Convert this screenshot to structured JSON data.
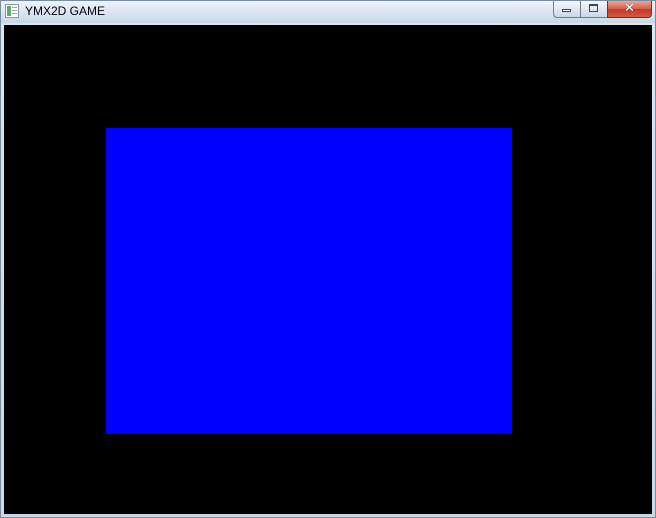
{
  "window": {
    "title": "YMX2D GAME",
    "icon": "app-window-icon",
    "controls": {
      "minimize_icon": "minimize-icon",
      "maximize_icon": "maximize-icon",
      "close_icon": "close-icon",
      "close_glyph": "✕"
    }
  },
  "canvas": {
    "background_color": "#000000",
    "shape": {
      "type": "rectangle",
      "fill_color": "#0000ff"
    }
  }
}
